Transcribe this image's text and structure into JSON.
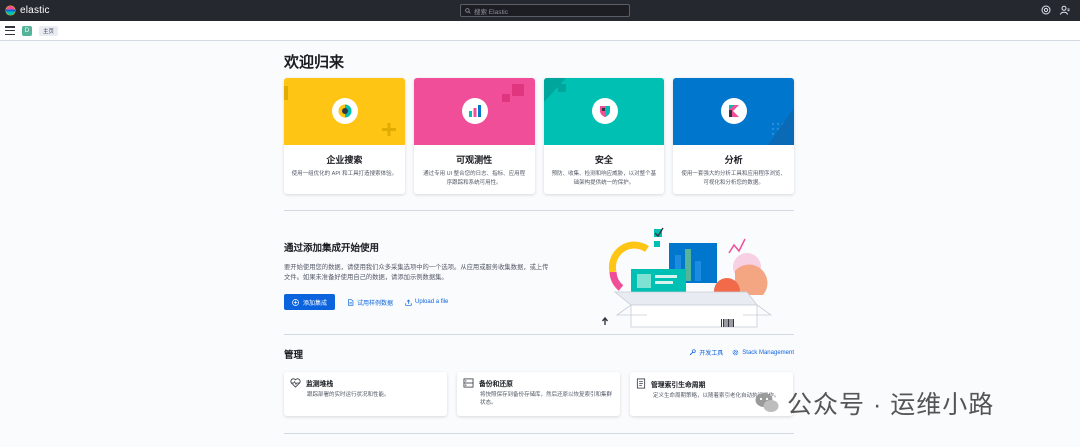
{
  "header": {
    "brand": "elastic",
    "search_placeholder": "搜索 Elastic"
  },
  "breadcrumb": {
    "space_initial": "D",
    "home": "主页"
  },
  "page_title": "欢迎归来",
  "solutions": [
    {
      "title": "企业搜索",
      "desc": "使用一组优化的 API 和工具打造搜索体验。",
      "color": "#fec514"
    },
    {
      "title": "可观测性",
      "desc": "通过专用 UI 整合您的日志、指标、应用程序跟踪和系统可用性。",
      "color": "#f04e98"
    },
    {
      "title": "安全",
      "desc": "预防、收集、检测和响应威胁，以对整个基础架构提供统一的保护。",
      "color": "#00bfb3"
    },
    {
      "title": "分析",
      "desc": "使用一套强大的分析工具和应用程序浏览、可视化和分析您的数据。",
      "color": "#0077cc"
    }
  ],
  "integrations": {
    "title": "通过添加集成开始使用",
    "desc": "要开始使用您的数据，请使用我们众多采集选项中的一个选项。从应用或服务收集数据，或上传文件。如果未准备好使用自己的数据，请添加示例数据集。",
    "add_button": "添加集成",
    "sample_link": "试用样例数据",
    "upload_link": "Upload a file"
  },
  "management": {
    "title": "管理",
    "dev_tools": "开发工具",
    "stack_management": "Stack Management",
    "cards": [
      {
        "title": "监测堆栈",
        "desc": "跟踪部署的实时运行状况和性能。",
        "icon": "heartbeat-icon"
      },
      {
        "title": "备份和还原",
        "desc": "将快照保存到备份存储库，然后还原以恢复索引和集群状态。",
        "icon": "database-icon"
      },
      {
        "title": "管理索引生命周期",
        "desc": "定义生命周期策略，以随着索引老化自动执行操作。",
        "icon": "index-list-icon"
      }
    ]
  },
  "watermark": {
    "text": "公众号 · 运维小路"
  }
}
